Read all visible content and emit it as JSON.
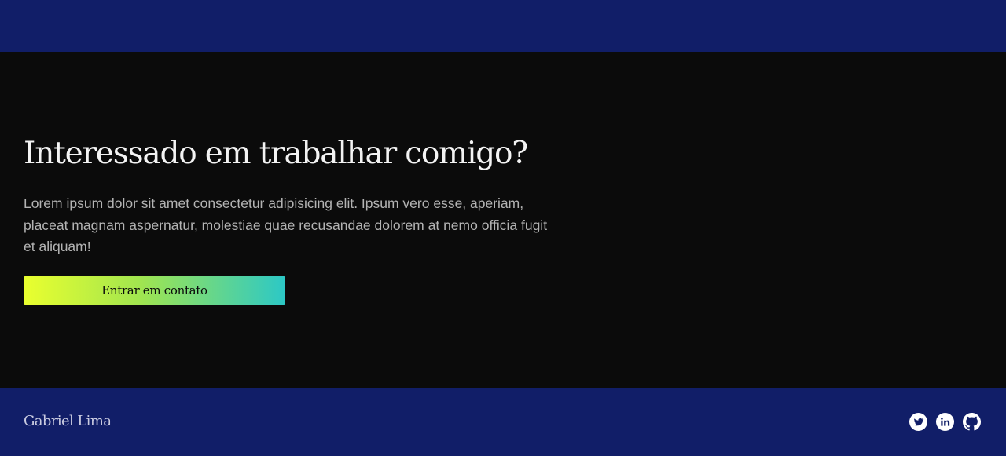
{
  "cta": {
    "title": "Interessado em trabalhar comigo?",
    "text": "Lorem ipsum dolor sit amet consectetur adipisicing elit. Ipsum vero esse, aperiam, placeat magnam aspernatur, molestiae quae recusandae dolorem at nemo officia fugit et aliquam!",
    "button_label": "Entrar em contato"
  },
  "footer": {
    "name": "Gabriel Lima",
    "social_icons": [
      "twitter-icon",
      "linkedin-icon",
      "github-icon"
    ]
  },
  "colors": {
    "nav_background": "#111e68",
    "page_background": "#0b0b0b",
    "button_gradient_start": "#eaff2e",
    "button_gradient_end": "#2cc8c6"
  }
}
